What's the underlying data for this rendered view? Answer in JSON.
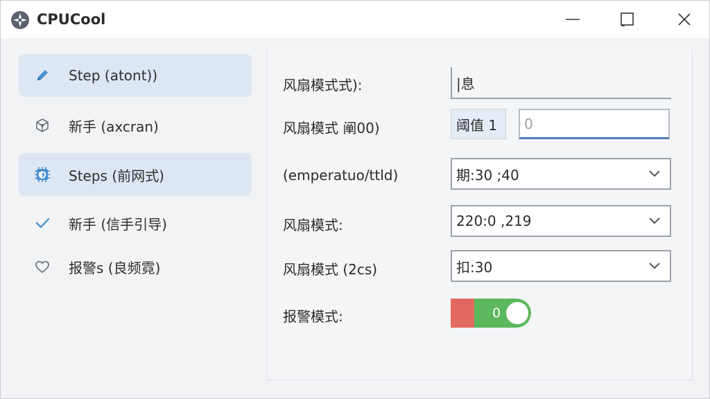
{
  "window": {
    "title": "CPUCool",
    "controls": {
      "minimize": "minimize",
      "maximize": "maximize",
      "close": "close"
    }
  },
  "sidebar": {
    "items": [
      {
        "label": "Step (atont))",
        "icon": "pencil-icon",
        "active": true
      },
      {
        "label": "新手 (axcran)",
        "icon": "cube-icon",
        "active": false
      },
      {
        "label": "Steps (前网式)",
        "icon": "chip-shield-icon",
        "active": true
      },
      {
        "label": "新手 (信手引导)",
        "icon": "check-icon",
        "active": false
      },
      {
        "label": "报警s (良频霓)",
        "icon": "heart-icon",
        "active": false
      }
    ]
  },
  "form": {
    "rows": [
      {
        "label": "风扇模式式):",
        "value": "|息"
      },
      {
        "label": "风扇模式 阐00)",
        "value_a": "阈值 1",
        "value_b": "0"
      },
      {
        "label": "(emperatuo/ttld)",
        "value": "期:30 ;40"
      },
      {
        "label": "风扇模式:",
        "value": "220:0 ,219"
      },
      {
        "label": "风扇模式 (2cs)",
        "value": "扣:30"
      },
      {
        "label": "报警模式:",
        "toggle_text": "0",
        "toggle_on": true
      }
    ]
  },
  "colors": {
    "accent": "#4f7fb8",
    "active_nav": "#dde7f3",
    "toggle_on": "#5cb85c",
    "toggle_off": "#e06a60",
    "icon_blue": "#4a8fd0"
  }
}
